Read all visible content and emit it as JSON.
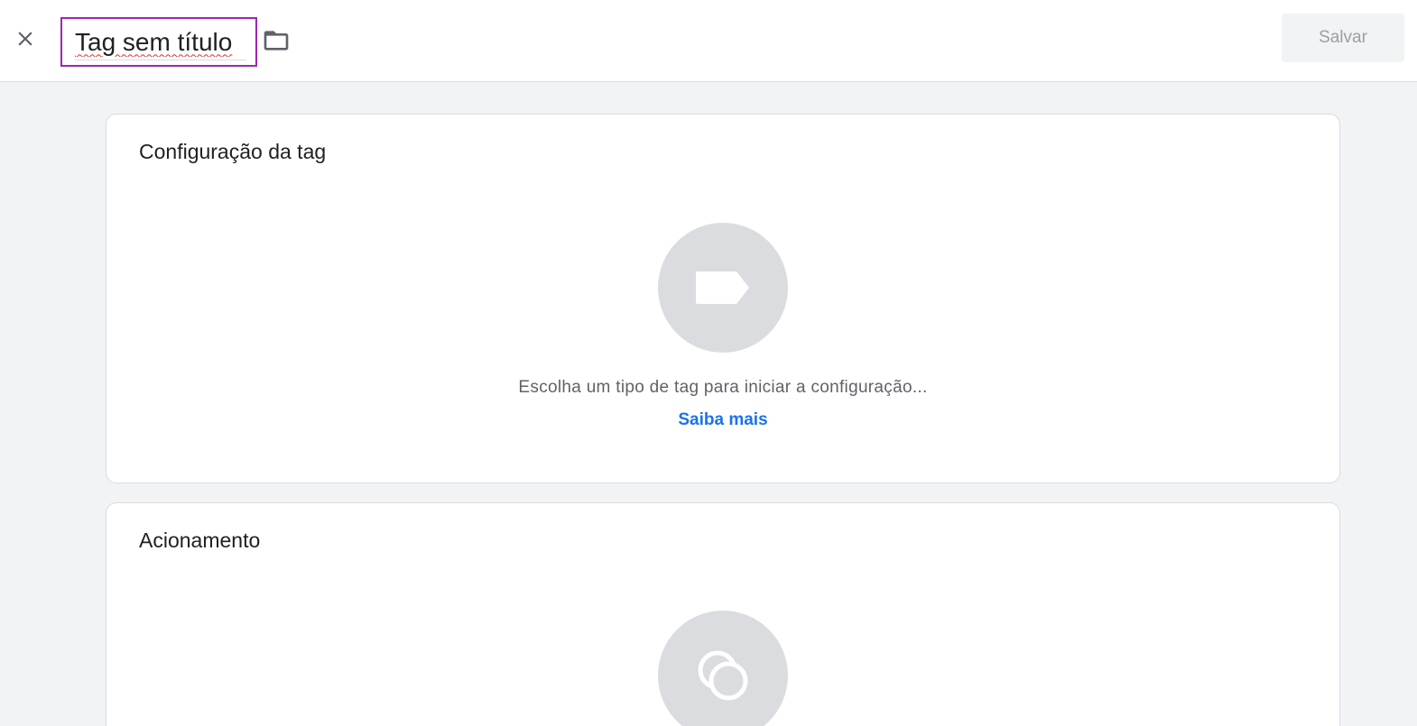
{
  "header": {
    "title_value": "Tag sem título",
    "save_label": "Salvar"
  },
  "tag_config": {
    "title": "Configuração da tag",
    "hint": "Escolha um tipo de tag para iniciar a configuração...",
    "learn_more": "Saiba mais"
  },
  "triggering": {
    "title": "Acionamento"
  },
  "colors": {
    "accent": "#1a73e8",
    "focus_border": "#9c27b0",
    "placeholder_circle": "#dadce0",
    "background": "#f1f3f4"
  },
  "icons": [
    "close-icon",
    "folder-icon",
    "tag-icon",
    "trigger-icon"
  ]
}
